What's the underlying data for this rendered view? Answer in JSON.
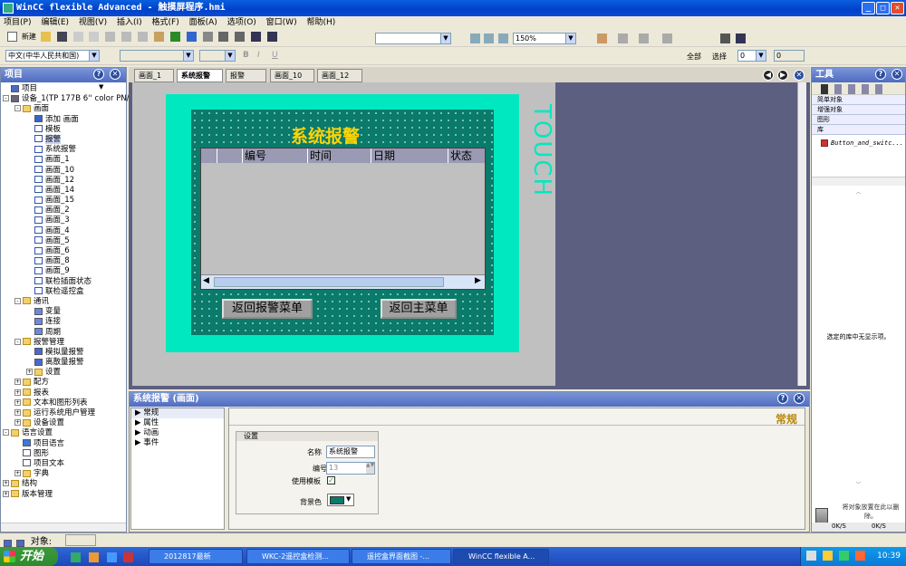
{
  "window": {
    "title": "WinCC flexible Advanced - 触摸屏程序.hmi",
    "min": "_",
    "max": "□",
    "close": "✕"
  },
  "menu": [
    "项目(P)",
    "编辑(E)",
    "视图(V)",
    "插入(I)",
    "格式(F)",
    "面板(A)",
    "选项(O)",
    "窗口(W)",
    "帮助(H)"
  ],
  "toolbar": {
    "new_label": "新建",
    "zoom": "150%",
    "lang": "中文(中华人民共和国)",
    "all_label": "全部",
    "select_label": "选择",
    "num1": "0",
    "num2": "0"
  },
  "project_panel": {
    "title": "项目",
    "tree": [
      {
        "t": "项目",
        "i": "root",
        "d": 0
      },
      {
        "t": "设备_1(TP 177B 6'' color PN/DP)",
        "i": "device",
        "d": 0,
        "e": "-"
      },
      {
        "t": "画面",
        "i": "fold",
        "d": 1,
        "e": "-"
      },
      {
        "t": "添加 画面",
        "i": "add",
        "d": 2
      },
      {
        "t": "模板",
        "i": "scr",
        "d": 2
      },
      {
        "t": "报警",
        "i": "scr",
        "d": 2
      },
      {
        "t": "系统报警",
        "i": "scr",
        "d": 2
      },
      {
        "t": "画面_1",
        "i": "scr",
        "d": 2
      },
      {
        "t": "画面_10",
        "i": "scr",
        "d": 2
      },
      {
        "t": "画面_12",
        "i": "scr",
        "d": 2
      },
      {
        "t": "画面_14",
        "i": "scr",
        "d": 2
      },
      {
        "t": "画面_15",
        "i": "scr",
        "d": 2
      },
      {
        "t": "画面_2",
        "i": "scr",
        "d": 2
      },
      {
        "t": "画面_3",
        "i": "scr",
        "d": 2
      },
      {
        "t": "画面_4",
        "i": "scr",
        "d": 2
      },
      {
        "t": "画面_5",
        "i": "scr",
        "d": 2
      },
      {
        "t": "画面_6",
        "i": "scr",
        "d": 2
      },
      {
        "t": "画面_8",
        "i": "scr",
        "d": 2
      },
      {
        "t": "画面_9",
        "i": "scr",
        "d": 2
      },
      {
        "t": "联检插面状态",
        "i": "scr",
        "d": 2
      },
      {
        "t": "联检遥控盒",
        "i": "scr",
        "d": 2
      },
      {
        "t": "通讯",
        "i": "fold",
        "d": 1,
        "e": "-"
      },
      {
        "t": "变量",
        "i": "tag",
        "d": 2
      },
      {
        "t": "连接",
        "i": "conn",
        "d": 2
      },
      {
        "t": "周期",
        "i": "cyc",
        "d": 2
      },
      {
        "t": "报警管理",
        "i": "fold",
        "d": 1,
        "e": "-"
      },
      {
        "t": "模拟量报警",
        "i": "alarm",
        "d": 2
      },
      {
        "t": "离散量报警",
        "i": "alarm",
        "d": 2
      },
      {
        "t": "设置",
        "i": "fold",
        "d": 2,
        "e": "+"
      },
      {
        "t": "配方",
        "i": "fold",
        "d": 1,
        "e": "+"
      },
      {
        "t": "报表",
        "i": "fold",
        "d": 1,
        "e": "+"
      },
      {
        "t": "文本和图形列表",
        "i": "fold",
        "d": 1,
        "e": "+"
      },
      {
        "t": "运行系统用户管理",
        "i": "fold",
        "d": 1,
        "e": "+"
      },
      {
        "t": "设备设置",
        "i": "fold",
        "d": 1,
        "e": "+"
      },
      {
        "t": "语言设置",
        "i": "fold",
        "d": 0,
        "e": "-"
      },
      {
        "t": "项目语言",
        "i": "globe",
        "d": 1
      },
      {
        "t": "图形",
        "i": "img",
        "d": 1
      },
      {
        "t": "项目文本",
        "i": "txt",
        "d": 1
      },
      {
        "t": "字典",
        "i": "fold",
        "d": 1,
        "e": "+"
      },
      {
        "t": "结构",
        "i": "fold",
        "d": 0,
        "e": "+"
      },
      {
        "t": "版本管理",
        "i": "fold",
        "d": 0,
        "e": "+"
      }
    ]
  },
  "tabs": [
    "画面_1",
    "系统报警",
    "报警",
    "画面_10",
    "画面_12"
  ],
  "hmi": {
    "title": "系统报警",
    "touch": "TOUCH",
    "columns": [
      "编号",
      "时间",
      "日期",
      "状态"
    ],
    "btn_alarm_menu": "返回报警菜单",
    "btn_main_menu": "返回主菜单"
  },
  "tools_panel": {
    "title": "工具",
    "sections": [
      "简单对象",
      "增强对象",
      "图形",
      "库"
    ],
    "lib_item": "Button_and_switc...",
    "empty_msg": "选定的库中无显示项。",
    "drop_msg": "将对象放置在此以删除。",
    "stat1": "0K/S",
    "stat2": "0K/S"
  },
  "props_panel": {
    "title": "系统报警 (画面)",
    "nav": [
      "常规",
      "属性",
      "动画",
      "事件"
    ],
    "heading": "常规",
    "group": "设置",
    "name_label": "名称",
    "name_value": "系统报警",
    "num_label": "编号",
    "num_value": "13",
    "tmpl_label": "使用模板",
    "bg_label": "背景色"
  },
  "statusbar": {
    "obj_label": "对象:"
  },
  "taskbar": {
    "start": "开始",
    "items": [
      "2012817最新",
      "WKC-2遥控盒检测...",
      "遥控盒界面截图 -...",
      "WinCC flexible A..."
    ],
    "clock": "10:39"
  }
}
